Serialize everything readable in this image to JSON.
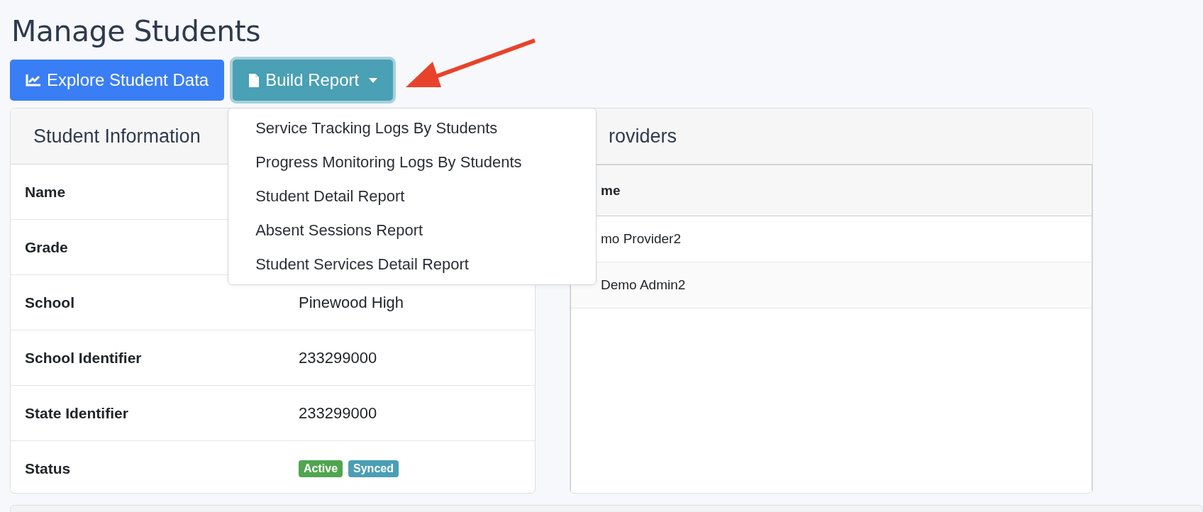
{
  "page_title": "Manage Students",
  "toolbar": [
    {
      "kind": "chart",
      "label": "Explore Student Data"
    },
    {
      "kind": "file",
      "label": "Build Report",
      "expanded": true
    }
  ],
  "report_menu": [
    "Service Tracking Logs By Students",
    "Progress Monitoring Logs By Students",
    "Student Detail Report",
    "Absent Sessions Report",
    "Student Services Detail Report"
  ],
  "student_information": {
    "title": "Student Information",
    "rows": [
      {
        "label": "Name"
      },
      {
        "label": "Grade"
      },
      {
        "label": "School",
        "value": "Pinewood High"
      },
      {
        "label": "School Identifier",
        "value": "233299000"
      },
      {
        "label": "State Identifier",
        "value": "233299000"
      },
      {
        "label": "Status",
        "badges": [
          {
            "text": "Active",
            "color": "#4fa64f"
          },
          {
            "text": "Synced",
            "color": "#4a9fb5"
          }
        ]
      }
    ]
  },
  "providers": {
    "title": "roviders",
    "column": "me",
    "rows": [
      "mo Provider2",
      "Demo Admin2"
    ]
  }
}
